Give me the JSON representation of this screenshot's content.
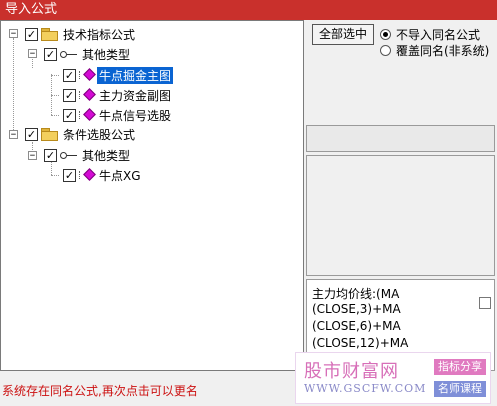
{
  "window": {
    "title": "导入公式"
  },
  "tree": {
    "groups": [
      {
        "label": "技术指标公式",
        "category": "其他类型",
        "items": [
          "牛点掘金主图",
          "主力资金副图",
          "牛点信号选股"
        ],
        "selected_item": "牛点掘金主图"
      },
      {
        "label": "条件选股公式",
        "category": "其他类型",
        "items": [
          "牛点XG"
        ]
      }
    ]
  },
  "options": {
    "select_all_label": "全部选中",
    "radio_skip_label": "不导入同名公式",
    "radio_overwrite_label": "覆盖同名(非系统)",
    "selected_radio": "radio_skip_label"
  },
  "preview": {
    "lines": [
      "主力均价线:(MA",
      "(CLOSE,3)+MA",
      "(CLOSE,6)+MA",
      "(CLOSE,12)+MA"
    ]
  },
  "status": {
    "message": "系统存在同名公式,再次点击可以更名"
  },
  "watermark": {
    "site_name": "股市财富网",
    "url": "WWW.GSCFW.COM",
    "tag_formula_share": "指标分享",
    "tag_teacher_course": "名师课程"
  },
  "colors": {
    "title_bg": "#c9302c",
    "selection_bg": "#0a64d2",
    "status_text": "#cc1111"
  }
}
